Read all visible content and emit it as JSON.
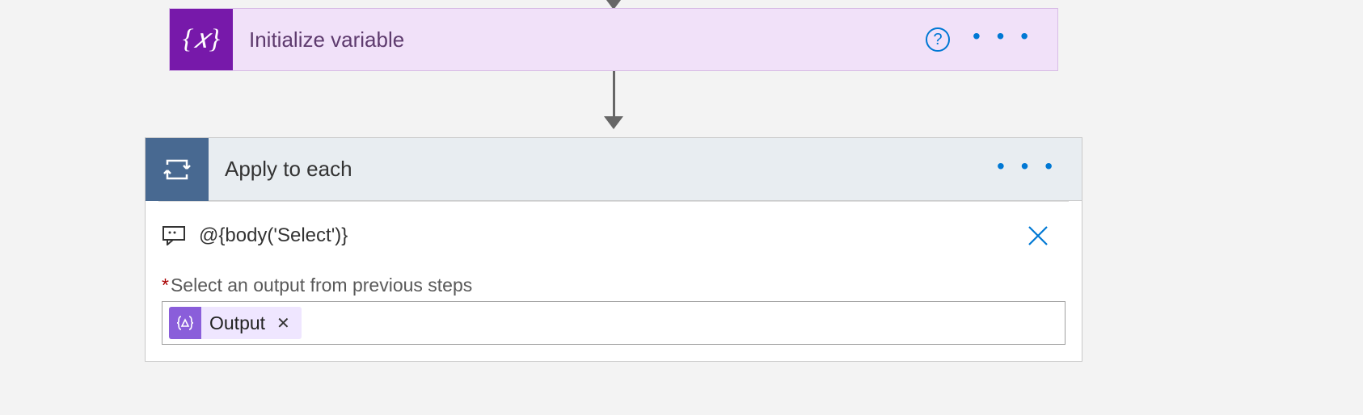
{
  "init_action": {
    "title": "Initialize variable",
    "icon_text": "{𝑥}"
  },
  "loop_action": {
    "title": "Apply to each",
    "expression": "@{body('Select')}",
    "field_label": "Select an output from previous steps",
    "token": {
      "label": "Output"
    }
  },
  "symbols": {
    "more": "• • •",
    "help": "?",
    "close_x": "✕"
  }
}
